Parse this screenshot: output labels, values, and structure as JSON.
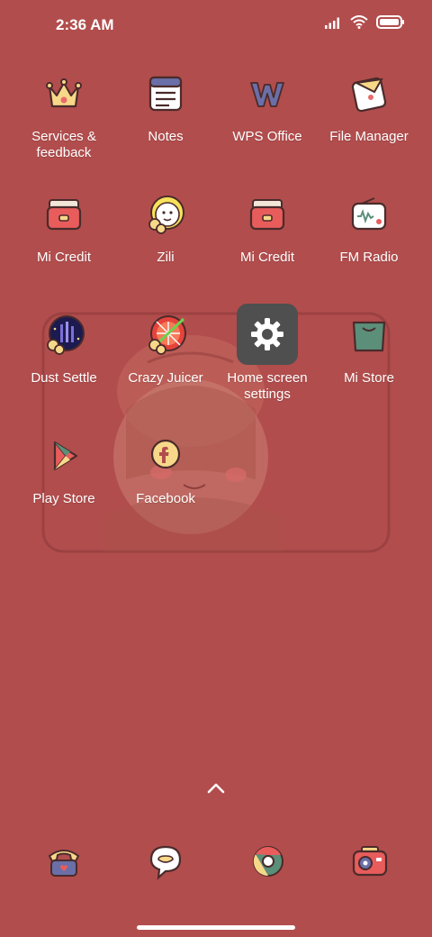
{
  "status": {
    "time": "2:36 AM"
  },
  "apps": [
    {
      "name": "services-feedback",
      "label": "Services &\nfeedback",
      "icon": "crown-icon"
    },
    {
      "name": "notes",
      "label": "Notes",
      "icon": "notes-icon"
    },
    {
      "name": "wps-office",
      "label": "WPS Office",
      "icon": "wps-icon"
    },
    {
      "name": "file-manager",
      "label": "File Manager",
      "icon": "folder-icon"
    },
    {
      "name": "mi-credit-1",
      "label": "Mi Credit",
      "icon": "wallet-icon"
    },
    {
      "name": "zili",
      "label": "Zili",
      "icon": "zili-icon"
    },
    {
      "name": "mi-credit-2",
      "label": "Mi Credit",
      "icon": "wallet-icon"
    },
    {
      "name": "fm-radio",
      "label": "FM Radio",
      "icon": "radio-icon"
    },
    {
      "name": "dust-settle",
      "label": "Dust Settle",
      "icon": "dust-settle-icon"
    },
    {
      "name": "crazy-juicer",
      "label": "Crazy Juicer",
      "icon": "crazy-juicer-icon"
    },
    {
      "name": "home-screen-settings",
      "label": "Home screen\nsettings",
      "icon": "gear-icon"
    },
    {
      "name": "mi-store",
      "label": "Mi Store",
      "icon": "shopping-bag-icon"
    },
    {
      "name": "play-store",
      "label": "Play Store",
      "icon": "play-store-icon"
    },
    {
      "name": "facebook",
      "label": "Facebook",
      "icon": "facebook-icon"
    }
  ],
  "dock": [
    {
      "name": "phone",
      "icon": "phone-icon"
    },
    {
      "name": "messages",
      "icon": "message-icon"
    },
    {
      "name": "browser",
      "icon": "browser-icon"
    },
    {
      "name": "camera",
      "icon": "camera-icon"
    }
  ],
  "colors": {
    "background": "#b24d4d",
    "wallpaper_line": "#8e3a3a",
    "settings_tile": "#4f4f4f"
  }
}
